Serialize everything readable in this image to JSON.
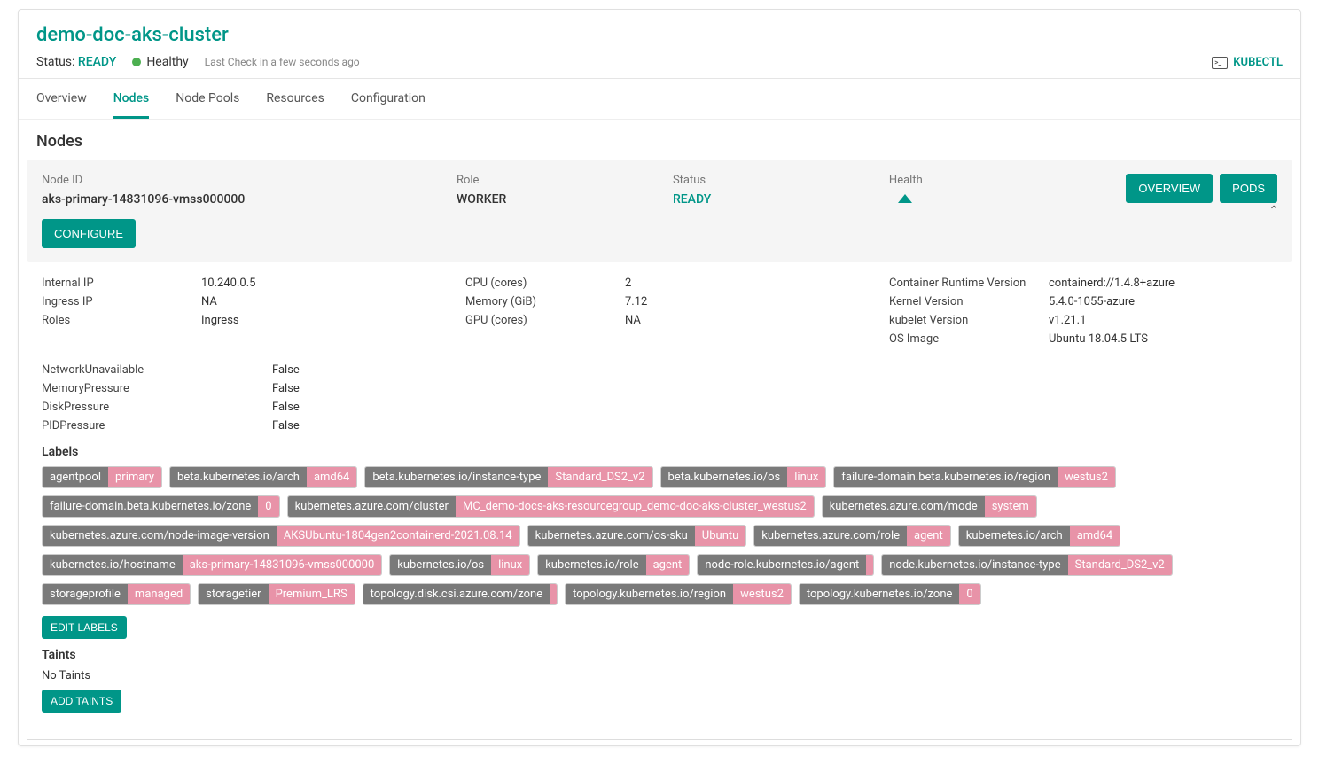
{
  "header": {
    "cluster_name": "demo-doc-aks-cluster",
    "status_label": "Status:",
    "status_value": "READY",
    "health_text": "Healthy",
    "last_check": "Last Check in a few seconds ago",
    "kubectl_label": "KUBECTL"
  },
  "tabs": [
    {
      "label": "Overview"
    },
    {
      "label": "Nodes"
    },
    {
      "label": "Node Pools"
    },
    {
      "label": "Resources"
    },
    {
      "label": "Configuration"
    }
  ],
  "section_title": "Nodes",
  "node": {
    "columns": {
      "id_label": "Node ID",
      "id_value": "aks-primary-14831096-vmss000000",
      "role_label": "Role",
      "role_value": "WORKER",
      "status_label": "Status",
      "status_value": "READY",
      "health_label": "Health"
    },
    "buttons": {
      "overview": "OVERVIEW",
      "pods": "PODS",
      "configure": "CONFIGURE"
    }
  },
  "details": {
    "col1": [
      {
        "k": "Internal IP",
        "v": "10.240.0.5"
      },
      {
        "k": "Ingress IP",
        "v": "NA"
      },
      {
        "k": "Roles",
        "v": "Ingress"
      }
    ],
    "col2": [
      {
        "k": "CPU (cores)",
        "v": "2"
      },
      {
        "k": "Memory (GiB)",
        "v": "7.12"
      },
      {
        "k": "GPU (cores)",
        "v": "NA"
      }
    ],
    "col3": [
      {
        "k": "Container Runtime Version",
        "v": "containerd://1.4.8+azure"
      },
      {
        "k": "Kernel Version",
        "v": "5.4.0-1055-azure"
      },
      {
        "k": "kubelet Version",
        "v": "v1.21.1"
      },
      {
        "k": "OS Image",
        "v": "Ubuntu 18.04.5 LTS"
      }
    ]
  },
  "conditions": [
    {
      "k": "NetworkUnavailable",
      "v": "False"
    },
    {
      "k": "MemoryPressure",
      "v": "False"
    },
    {
      "k": "DiskPressure",
      "v": "False"
    },
    {
      "k": "PIDPressure",
      "v": "False"
    }
  ],
  "labels_heading": "Labels",
  "labels": [
    {
      "k": "agentpool",
      "v": "primary"
    },
    {
      "k": "beta.kubernetes.io/arch",
      "v": "amd64"
    },
    {
      "k": "beta.kubernetes.io/instance-type",
      "v": "Standard_DS2_v2"
    },
    {
      "k": "beta.kubernetes.io/os",
      "v": "linux"
    },
    {
      "k": "failure-domain.beta.kubernetes.io/region",
      "v": "westus2"
    },
    {
      "k": "failure-domain.beta.kubernetes.io/zone",
      "v": "0"
    },
    {
      "k": "kubernetes.azure.com/cluster",
      "v": "MC_demo-docs-aks-resourcegroup_demo-doc-aks-cluster_westus2"
    },
    {
      "k": "kubernetes.azure.com/mode",
      "v": "system"
    },
    {
      "k": "kubernetes.azure.com/node-image-version",
      "v": "AKSUbuntu-1804gen2containerd-2021.08.14"
    },
    {
      "k": "kubernetes.azure.com/os-sku",
      "v": "Ubuntu"
    },
    {
      "k": "kubernetes.azure.com/role",
      "v": "agent"
    },
    {
      "k": "kubernetes.io/arch",
      "v": "amd64"
    },
    {
      "k": "kubernetes.io/hostname",
      "v": "aks-primary-14831096-vmss000000"
    },
    {
      "k": "kubernetes.io/os",
      "v": "linux"
    },
    {
      "k": "kubernetes.io/role",
      "v": "agent"
    },
    {
      "k": "node-role.kubernetes.io/agent",
      "v": ""
    },
    {
      "k": "node.kubernetes.io/instance-type",
      "v": "Standard_DS2_v2"
    },
    {
      "k": "storageprofile",
      "v": "managed"
    },
    {
      "k": "storagetier",
      "v": "Premium_LRS"
    },
    {
      "k": "topology.disk.csi.azure.com/zone",
      "v": ""
    },
    {
      "k": "topology.kubernetes.io/region",
      "v": "westus2"
    },
    {
      "k": "topology.kubernetes.io/zone",
      "v": "0"
    }
  ],
  "edit_labels_btn": "EDIT LABELS",
  "taints_heading": "Taints",
  "taints_text": "No Taints",
  "add_taints_btn": "ADD TAINTS"
}
